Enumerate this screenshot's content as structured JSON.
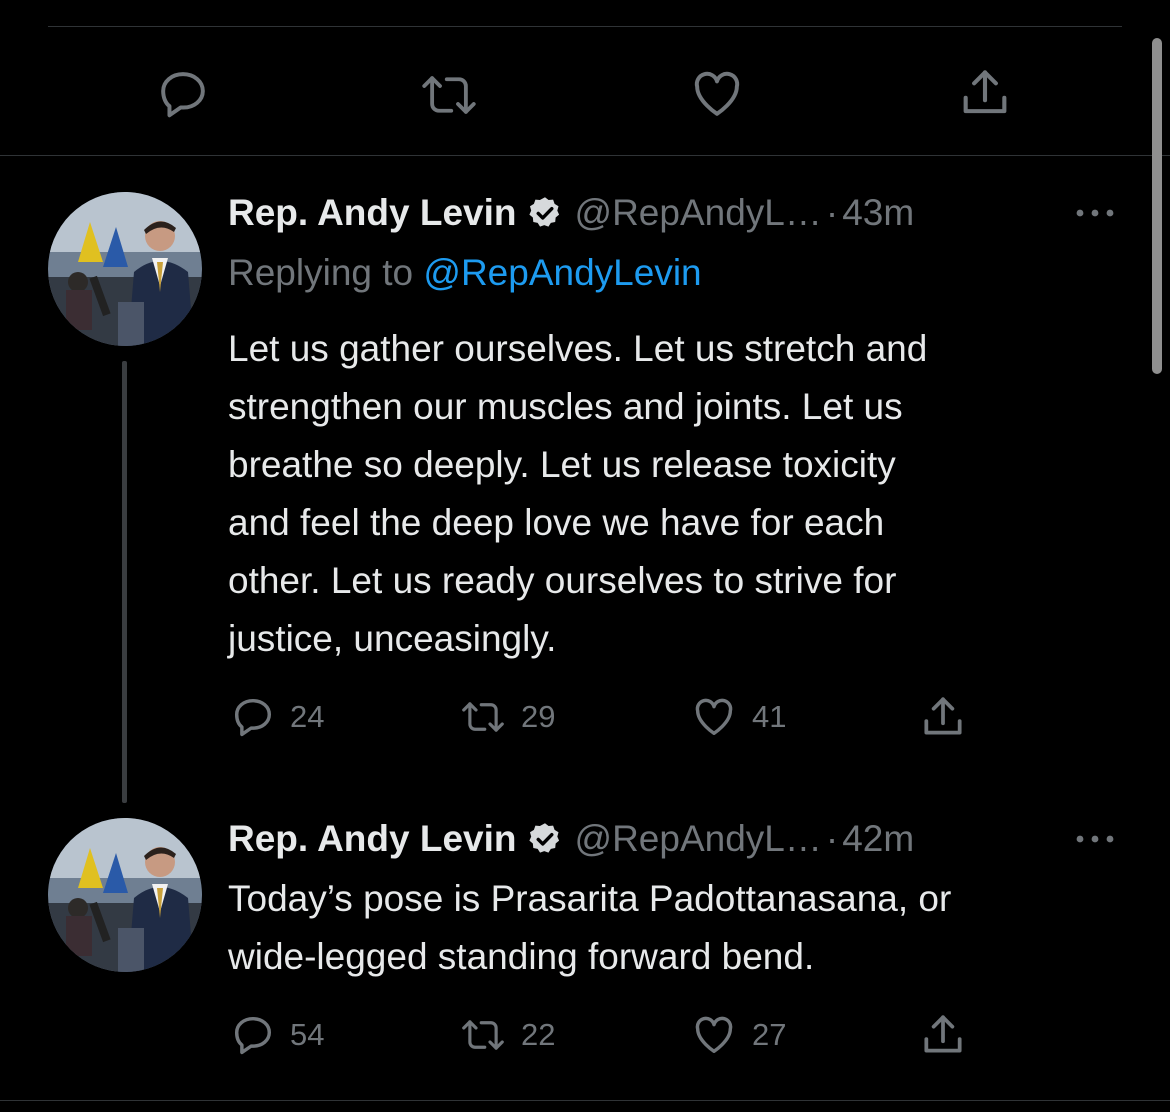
{
  "tweets": [
    {
      "name": "Rep. Andy Levin",
      "handle": "@RepAndyL…",
      "separator": "·",
      "time": "43m",
      "replying_label": "Replying to ",
      "replying_to": "@RepAndyLevin",
      "text": "Let us gather ourselves. Let us stretch and\nstrengthen our muscles and joints. Let us\nbreathe so deeply. Let us release toxicity\nand feel the deep love we have for each\nother. Let us ready ourselves to strive for\njustice, unceasingly.",
      "replies": "24",
      "retweets": "29",
      "likes": "41"
    },
    {
      "name": "Rep. Andy Levin",
      "handle": "@RepAndyL…",
      "separator": "·",
      "time": "42m",
      "text": "Today’s pose is Prasarita Padottanasana, or\nwide-legged standing forward bend.",
      "replies": "54",
      "retweets": "22",
      "likes": "27"
    }
  ],
  "icons": {
    "reply": "reply-icon",
    "retweet": "retweet-icon",
    "like": "heart-icon",
    "share": "share-icon",
    "verified": "verified-badge-icon",
    "more": "more-icon"
  },
  "colors": {
    "background": "#000000",
    "text": "#e7e9ea",
    "secondary": "#71767b",
    "link": "#1d9bf0"
  }
}
